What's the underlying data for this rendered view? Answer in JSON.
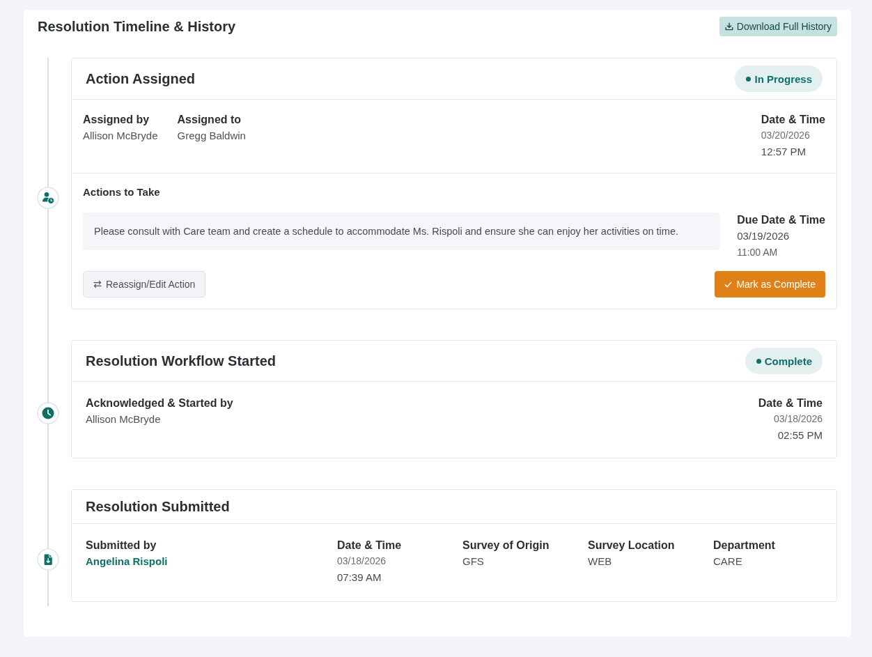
{
  "header": {
    "title": "Resolution Timeline & History",
    "download_button": {
      "label": "Download Full History"
    }
  },
  "timeline": [
    {
      "kind": "assigned",
      "title": "Action Assigned",
      "status": {
        "label": "In Progress"
      },
      "fields": [
        {
          "kind": "text",
          "label": "Assigned by",
          "value": "Allison McBryde"
        },
        {
          "kind": "text",
          "label": "Assigned to",
          "value": "Gregg Baldwin"
        },
        {
          "kind": "datetime",
          "label": "Date & Time",
          "date": "03/20/2026",
          "time": "12:57 PM"
        }
      ],
      "actions_to_take": {
        "heading": "Actions to Take",
        "note": "Please consult with Care team and create a schedule to accommodate Ms. Rispoli and ensure she can enjoy her activities on time.",
        "due": {
          "label": "Due Date & Time",
          "date": "03/19/2026",
          "time": "11:00 AM"
        }
      },
      "buttons": [
        {
          "kind": "secondary",
          "label": "Reassign/Edit Action"
        },
        {
          "kind": "primary",
          "label": "Mark as Complete"
        }
      ]
    },
    {
      "kind": "started",
      "title": "Resolution Workflow Started",
      "status": {
        "label": "Complete"
      },
      "fields": [
        {
          "kind": "text",
          "label": "Acknowledged & Started by",
          "value": "Allison McBryde"
        },
        {
          "kind": "datetime",
          "label": "Date & Time",
          "date": "03/18/2026",
          "time": "02:55 PM"
        }
      ]
    },
    {
      "kind": "submitted",
      "title": "Resolution Submitted",
      "fields": [
        {
          "kind": "link",
          "label": "Submitted by",
          "value": "Angelina Rispoli"
        },
        {
          "kind": "datetime",
          "label": "Date & Time",
          "date": "03/18/2026",
          "time": "07:39 AM"
        },
        {
          "kind": "text",
          "label": "Survey of Origin",
          "value": "GFS"
        },
        {
          "kind": "text",
          "label": "Survey Location",
          "value": "WEB"
        },
        {
          "kind": "text",
          "label": "Department",
          "value": "CARE"
        }
      ]
    }
  ]
}
